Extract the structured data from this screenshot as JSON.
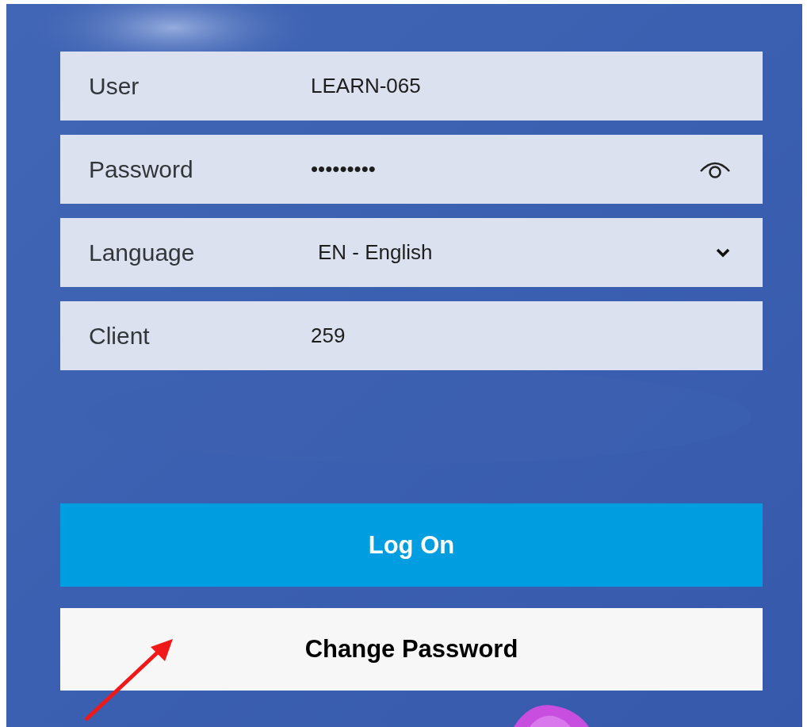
{
  "fields": [
    {
      "kind": "text",
      "label": "User",
      "value": "LEARN-065"
    },
    {
      "kind": "password",
      "label": "Password",
      "value": "•••••••••"
    },
    {
      "kind": "select",
      "label": "Language",
      "value": "EN - English"
    },
    {
      "kind": "text",
      "label": "Client",
      "value": "259"
    }
  ],
  "buttons": [
    {
      "kind": "primary",
      "label": "Log On"
    },
    {
      "kind": "secondary",
      "label": "Change Password"
    }
  ]
}
